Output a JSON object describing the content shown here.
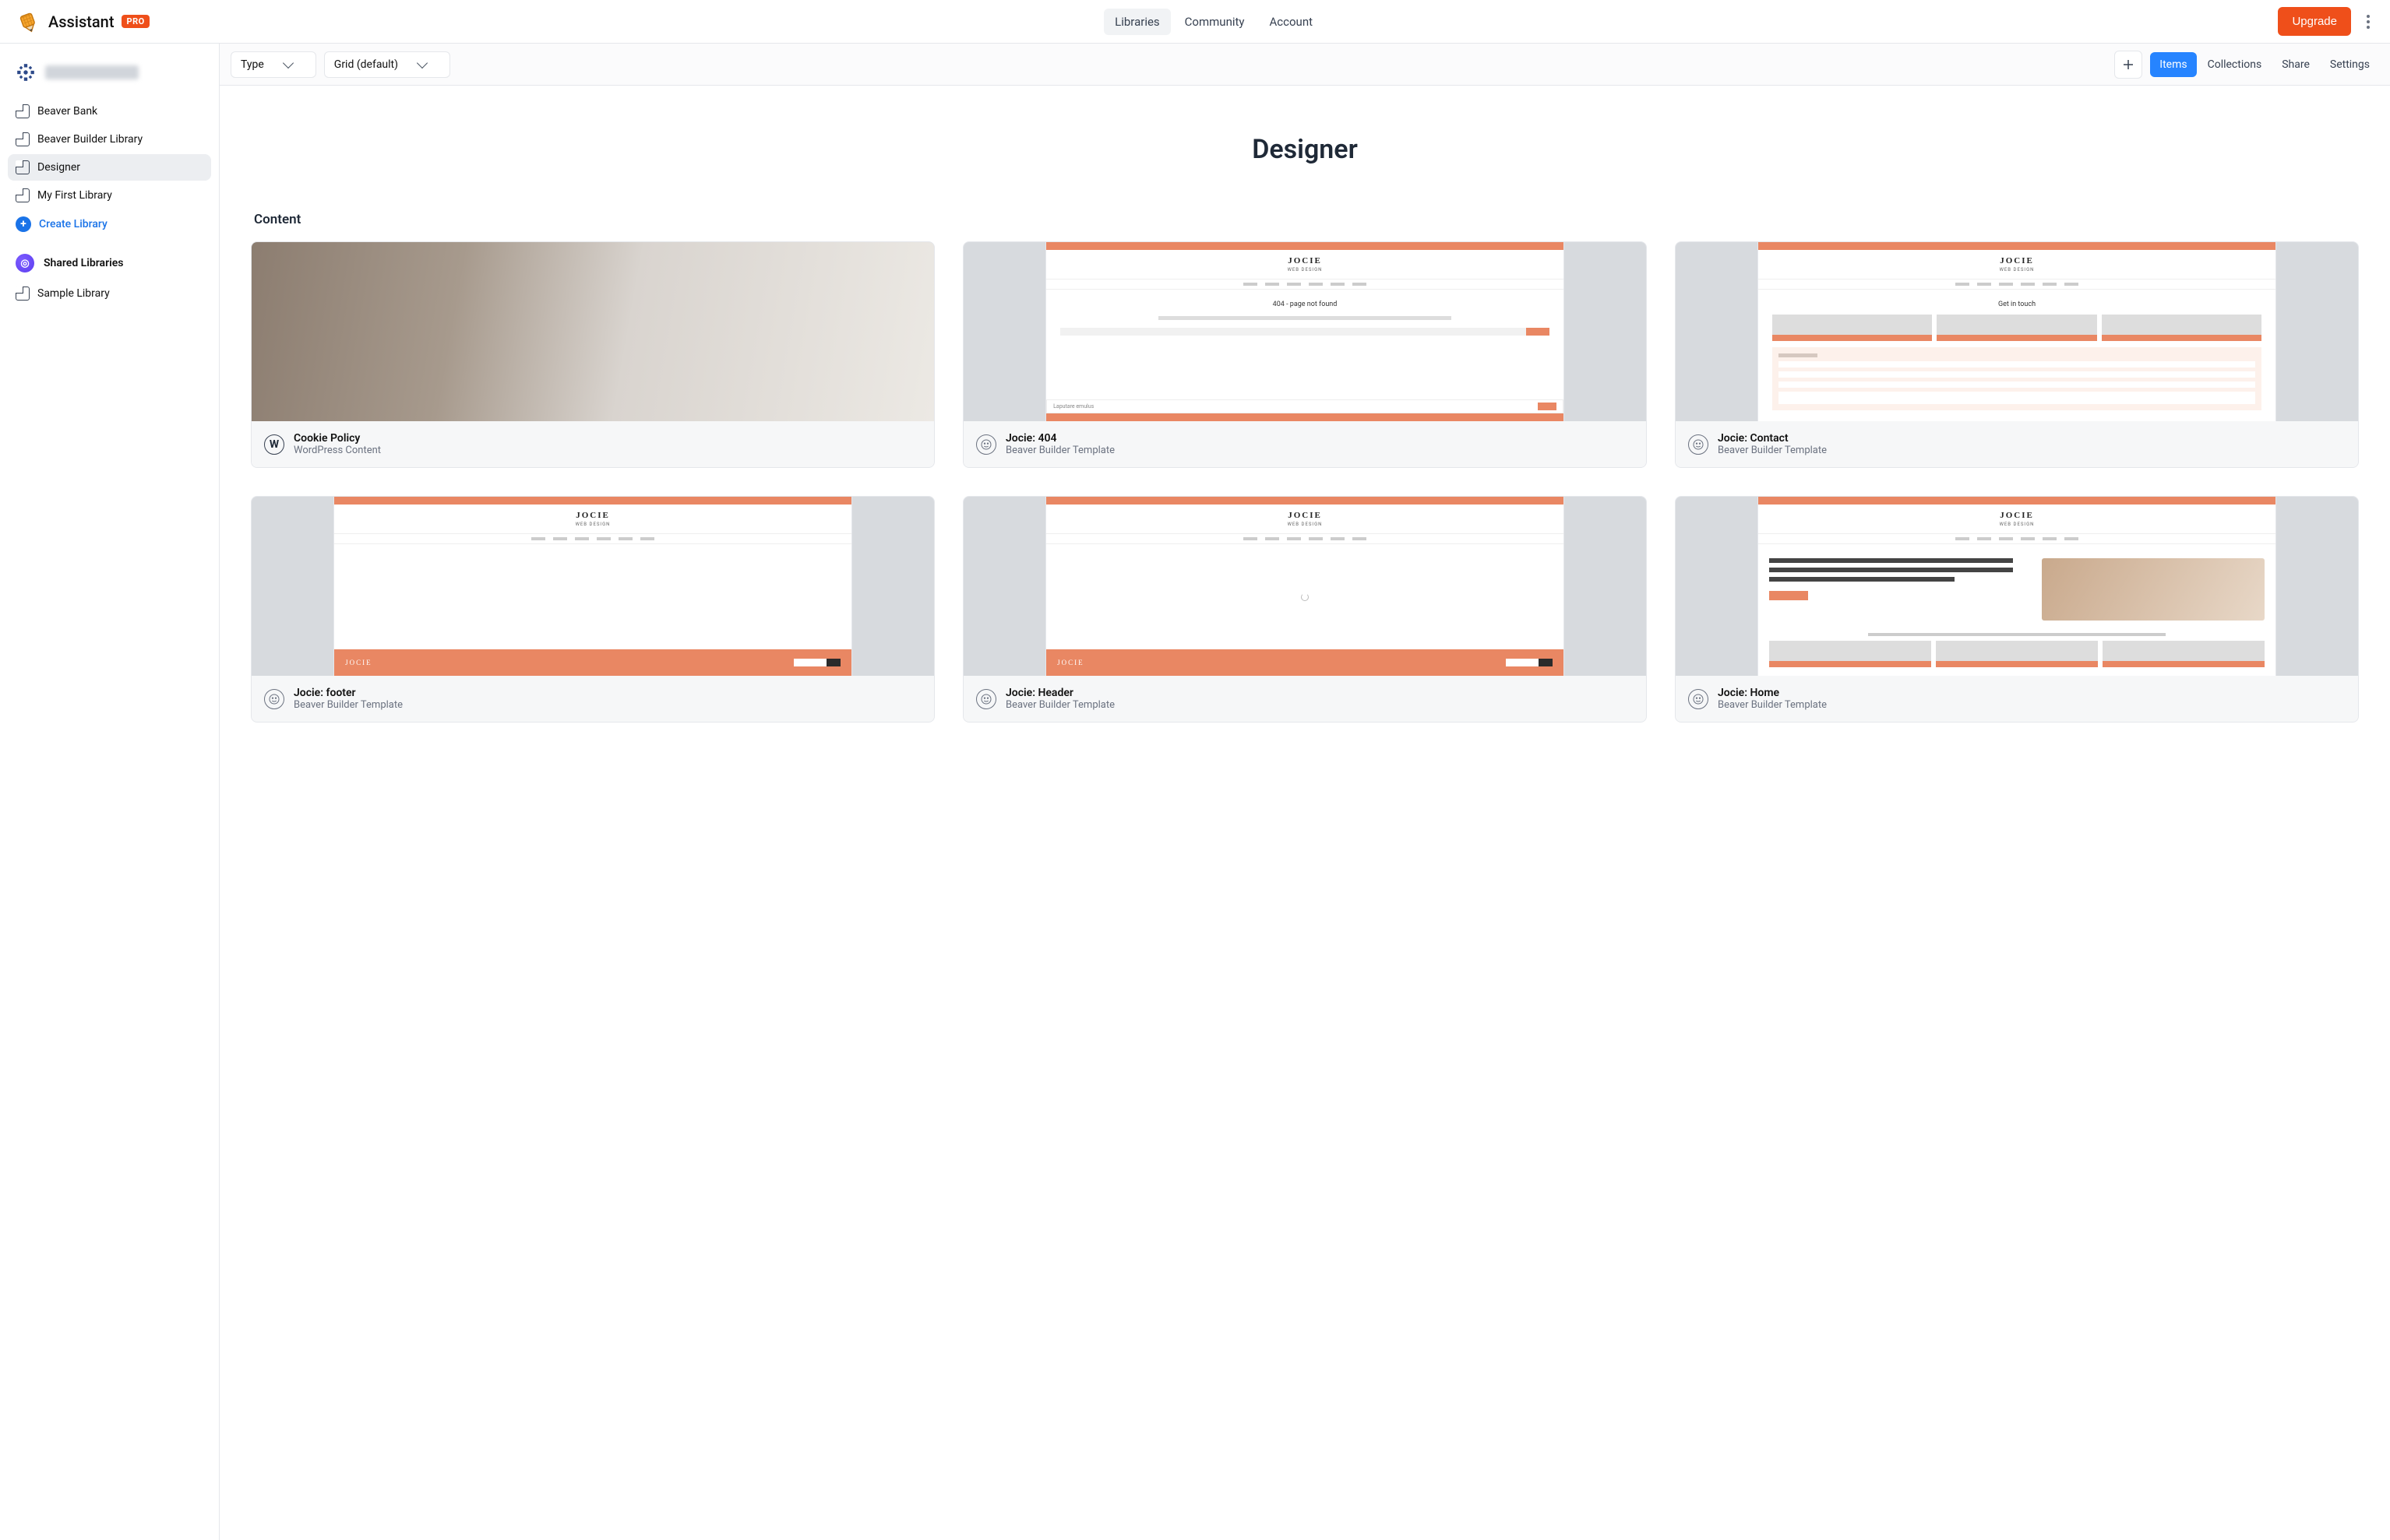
{
  "header": {
    "app_name": "Assistant",
    "pro_badge": "PRO",
    "nav": {
      "libraries": "Libraries",
      "community": "Community",
      "account": "Account"
    },
    "upgrade": "Upgrade"
  },
  "sidebar": {
    "user_name": "",
    "items": [
      {
        "label": "Beaver Bank"
      },
      {
        "label": "Beaver Builder Library"
      },
      {
        "label": "Designer"
      },
      {
        "label": "My First Library"
      }
    ],
    "create_label": "Create Library",
    "shared_heading": "Shared Libraries",
    "shared_items": [
      {
        "label": "Sample Library"
      }
    ]
  },
  "toolbar": {
    "filter_type": "Type",
    "filter_view": "Grid (default)",
    "tabs": {
      "items": "Items",
      "collections": "Collections",
      "share": "Share",
      "settings": "Settings"
    }
  },
  "page": {
    "title": "Designer",
    "section": "Content"
  },
  "cards": [
    {
      "title": "Cookie Policy",
      "subtitle": "WordPress Content",
      "kind": "wp",
      "thumb": "photo"
    },
    {
      "title": "Jocie: 404",
      "subtitle": "Beaver Builder Template",
      "kind": "bb",
      "thumb": "jocie-404"
    },
    {
      "title": "Jocie: Contact",
      "subtitle": "Beaver Builder Template",
      "kind": "bb",
      "thumb": "jocie-contact"
    },
    {
      "title": "Jocie: footer",
      "subtitle": "Beaver Builder Template",
      "kind": "bb",
      "thumb": "jocie-footer"
    },
    {
      "title": "Jocie: Header",
      "subtitle": "Beaver Builder Template",
      "kind": "bb",
      "thumb": "jocie-header"
    },
    {
      "title": "Jocie: Home",
      "subtitle": "Beaver Builder Template",
      "kind": "bb",
      "thumb": "jocie-home"
    }
  ],
  "brand": {
    "accent": "#ef4f1a",
    "primary_blue": "#2684ff"
  }
}
